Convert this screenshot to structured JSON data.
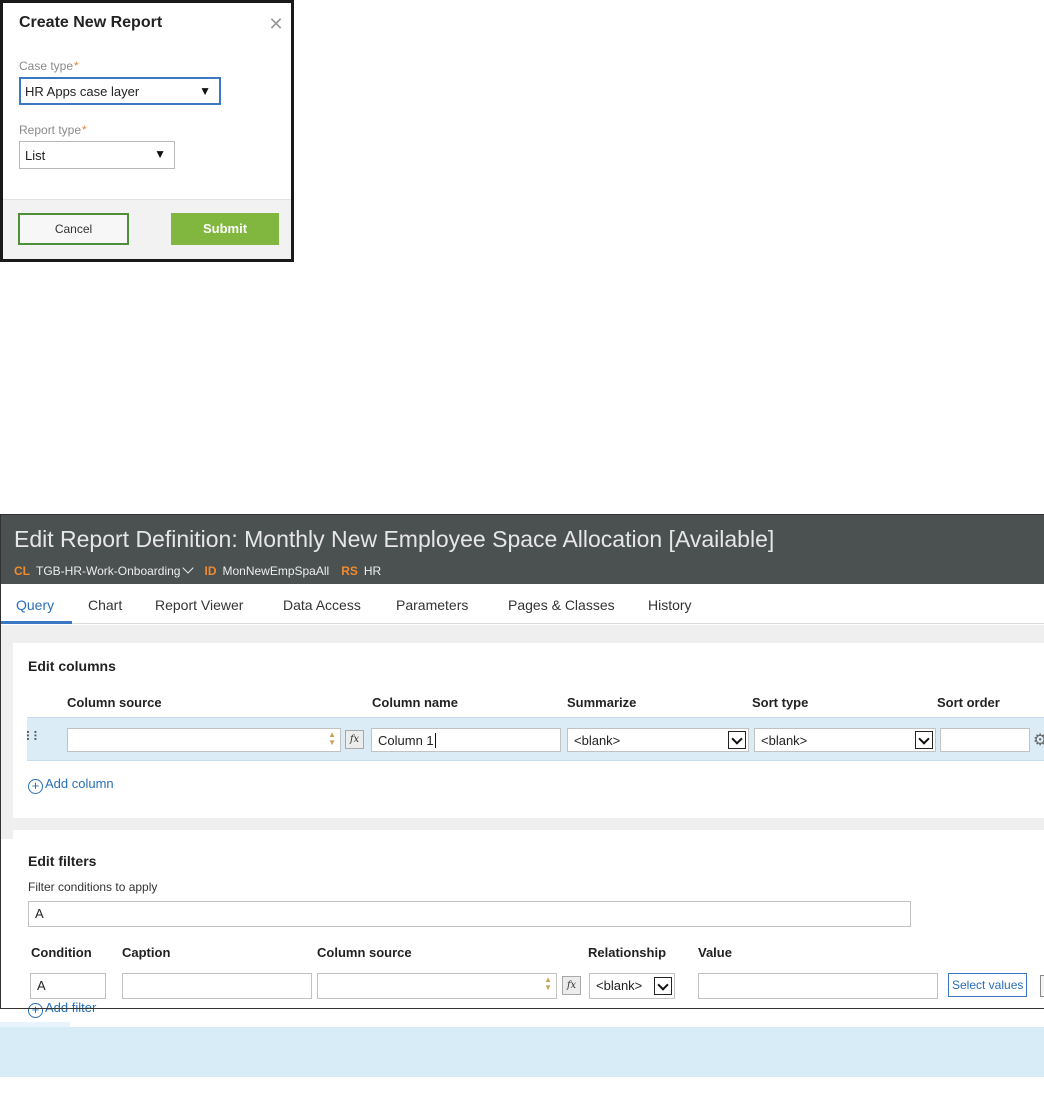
{
  "dialog": {
    "title": "Create New Report",
    "close_icon": "close-icon",
    "case_type_label": "Case type",
    "case_type_value": "HR Apps case layer",
    "report_type_label": "Report type",
    "report_type_value": "List",
    "required_mark": "*",
    "dropdown_arrow": "▼",
    "cancel_label": "Cancel",
    "submit_label": "Submit"
  },
  "header": {
    "title": "Edit Report Definition: Monthly New Employee Space Allocation [Available]",
    "cl_key": "CL",
    "cl_value": "TGB-HR-Work-Onboarding",
    "id_key": "ID",
    "id_value": "MonNewEmpSpaAll",
    "rs_key": "RS",
    "rs_value": "HR"
  },
  "tabs": [
    "Query",
    "Chart",
    "Report Viewer",
    "Data Access",
    "Parameters",
    "Pages & Classes",
    "History"
  ],
  "columns_panel": {
    "title": "Edit columns",
    "headers": [
      "Column source",
      "Column name",
      "Summarize",
      "Sort type",
      "Sort order"
    ],
    "row": {
      "column_source": "",
      "fx": "fx",
      "column_name": "Column 1",
      "summarize": "<blank>",
      "sort_type": "<blank>",
      "sort_order": ""
    },
    "add_label": "Add column"
  },
  "filters_panel": {
    "title": "Edit filters",
    "conditions_label": "Filter conditions to apply",
    "conditions_value": "A",
    "headers": [
      "Condition",
      "Caption",
      "Column source",
      "Relationship",
      "Value"
    ],
    "row": {
      "condition": "A",
      "caption": "",
      "column_source": "",
      "fx": "fx",
      "relationship": "<blank>",
      "value": "",
      "select_values": "Select values"
    },
    "add_label": "Add filter"
  },
  "colors": {
    "header_bg": "#4b5051",
    "accent_orange": "#f08a2e",
    "link_blue": "#2a6fb8",
    "submit_green": "#81b73e",
    "row_highlight": "#dcecf7"
  }
}
